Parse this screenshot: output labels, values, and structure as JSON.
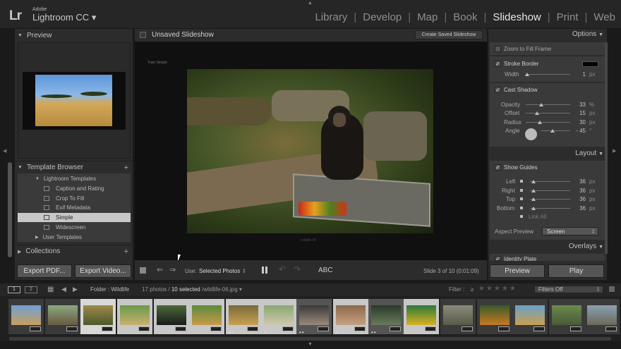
{
  "app": {
    "adobe": "Adobe",
    "product": "Lightroom CC",
    "product_caret": "▾",
    "logo": "Lr"
  },
  "modules": [
    "Library",
    "Develop",
    "Map",
    "Book",
    "Slideshow",
    "Print",
    "Web"
  ],
  "active_module": "Slideshow",
  "left_panel": {
    "preview_title": "Preview",
    "template_browser_title": "Template Browser",
    "plus": "+",
    "folders": [
      {
        "label": "Lightroom Templates",
        "expanded": true
      },
      {
        "label": "User Templates",
        "expanded": false
      }
    ],
    "templates": [
      "Caption and Rating",
      "Crop To Fill",
      "Exif Metadata",
      "Simple",
      "Widescreen"
    ],
    "selected_template": "Simple",
    "collections_title": "Collections",
    "export_pdf": "Export PDF...",
    "export_video": "Export Video..."
  },
  "center": {
    "title": "Unsaved Slideshow",
    "create_saved": "Create Saved Slideshow",
    "slide_identity": "Train Simple",
    "caption": "wildlife-06"
  },
  "toolbar": {
    "use_label": "Use:",
    "use_value": "Selected Photos",
    "use_caret": "⇕",
    "abc": "ABC",
    "slide_status": "Slide 3 of 10 (0:01:09)"
  },
  "right_panel": {
    "options_title": "Options",
    "zoom_to_fill": "Zoom to Fill Frame",
    "stroke_border": "Stroke Border",
    "width_label": "Width",
    "width_value": "1",
    "width_unit": "px",
    "cast_shadow": "Cast Shadow",
    "opacity_label": "Opacity",
    "opacity_value": "33",
    "opacity_unit": "%",
    "offset_label": "Offset",
    "offset_value": "15",
    "offset_unit": "px",
    "radius_label": "Radius",
    "radius_value": "30",
    "radius_unit": "px",
    "angle_label": "Angle",
    "angle_value": "- 45",
    "angle_unit": "°",
    "layout_title": "Layout",
    "show_guides": "Show Guides",
    "left_label": "Left",
    "left_value": "36",
    "right_label": "Right",
    "right_value": "36",
    "top_label": "Top",
    "top_value": "36",
    "bottom_label": "Bottom",
    "bottom_value": "36",
    "px": "px",
    "link_all": "Link All",
    "aspect_label": "Aspect Preview",
    "aspect_value": "Screen",
    "overlays_title": "Overlays",
    "identity_plate": "Identity Plate",
    "preview_btn": "Preview",
    "play_btn": "Play"
  },
  "filmstrip_bar": {
    "page1": "1",
    "page2": "2",
    "folder": "Folder : Wildlife",
    "count": "17 photos /",
    "selected": "10 selected",
    "file": "/wildlife-06.jpg",
    "file_caret": "▾",
    "filter_label": "Filter :",
    "filter_op": "≥",
    "stars": "★★★★★",
    "filters_off": "Filters Off"
  },
  "colors": {
    "accent_text": "#e6e6e6",
    "panel_bg": "#2c2c2c",
    "selected_row": "#c8c8c8"
  }
}
